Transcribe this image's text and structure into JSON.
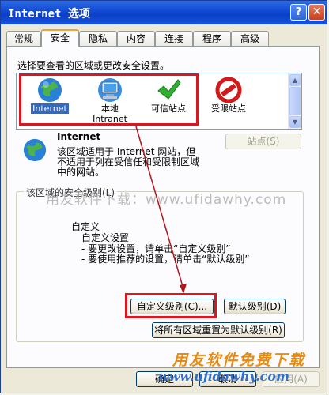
{
  "window": {
    "title": "Internet 选项",
    "help_label": "?",
    "close_label": "✕"
  },
  "tabs": [
    {
      "label": "常规"
    },
    {
      "label": "安全",
      "active": true
    },
    {
      "label": "隐私"
    },
    {
      "label": "内容"
    },
    {
      "label": "连接"
    },
    {
      "label": "程序"
    },
    {
      "label": "高级"
    }
  ],
  "security": {
    "instruction": "选择要查看的区域或更改安全设置。",
    "zones": [
      {
        "label": "Internet",
        "icon": "globe-icon",
        "selected": true
      },
      {
        "label_line1": "本地",
        "label_line2": "Intranet",
        "icon": "intranet-icon"
      },
      {
        "label": "可信站点",
        "icon": "check-icon"
      },
      {
        "label": "受限站点",
        "icon": "restricted-icon"
      }
    ],
    "zone_title": "Internet",
    "zone_desc": [
      "该区域适用于 Internet 网站，但",
      "不适用于列在受信任和受限制区域",
      "中的网站。"
    ],
    "sites_button": "站点(S)",
    "level_group_legend": "该区域的安全级别(L)",
    "custom_title": "自定义",
    "custom_lines": [
      "自定义设置",
      "- 要更改设置，请单击“自定义级别”",
      "- 要使用推荐的设置，请单击“默认级别”"
    ],
    "custom_level_button": "自定义级别(C)...",
    "default_level_button": "默认级别(D)",
    "reset_all_button": "将所有区域重置为默认级别(R)"
  },
  "footer": {
    "ok_button": "确定",
    "cancel_button": "取消",
    "apply_button": "应用(A)"
  },
  "watermarks": {
    "line1": "用友软件下载：www.ufidawhy.com",
    "line2": "用友软件免费下载",
    "line3": "www.ufidawhy.com"
  },
  "colors": {
    "title_bar": "#0b3fc6",
    "highlight_box": "#d8171e",
    "selection": "#316ac5"
  }
}
